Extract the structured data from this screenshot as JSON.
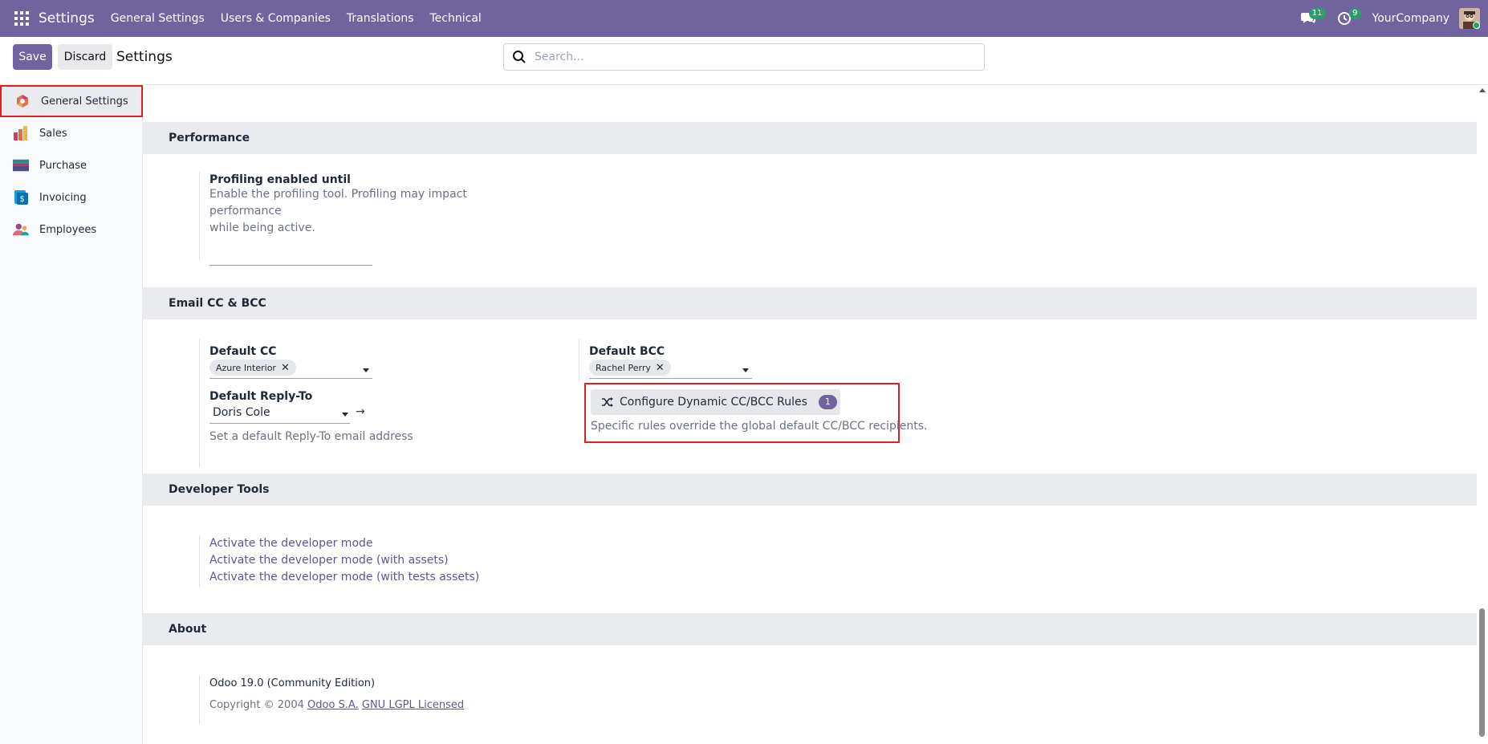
{
  "navbar": {
    "brand": "Settings",
    "menu": [
      "General Settings",
      "Users & Companies",
      "Translations",
      "Technical"
    ],
    "messages_count": "11",
    "activities_count": "9",
    "company": "YourCompany"
  },
  "control": {
    "save_label": "Save",
    "discard_label": "Discard",
    "title": "Settings",
    "search_placeholder": "Search..."
  },
  "sidebar": {
    "items": [
      {
        "label": "General Settings",
        "icon": "general-settings-icon",
        "active": true
      },
      {
        "label": "Sales",
        "icon": "sales-icon"
      },
      {
        "label": "Purchase",
        "icon": "purchase-icon"
      },
      {
        "label": "Invoicing",
        "icon": "invoicing-icon"
      },
      {
        "label": "Employees",
        "icon": "employees-icon"
      }
    ]
  },
  "sections": {
    "performance": {
      "title": "Performance",
      "profiling_label": "Profiling enabled until",
      "profiling_desc_1": "Enable the profiling tool. Profiling may impact performance",
      "profiling_desc_2": "while being active."
    },
    "email": {
      "title": "Email CC & BCC",
      "default_cc_label": "Default CC",
      "default_cc_tag": "Azure Interior",
      "default_bcc_label": "Default BCC",
      "default_bcc_tag": "Rachel Perry",
      "reply_to_label": "Default Reply-To",
      "reply_to_value": "Doris Cole",
      "reply_to_desc": "Set a default Reply-To email address",
      "rules_button": "Configure Dynamic CC/BCC Rules",
      "rules_count": "1",
      "rules_desc": "Specific rules override the global default CC/BCC recipients."
    },
    "developer": {
      "title": "Developer Tools",
      "links": [
        "Activate the developer mode",
        "Activate the developer mode (with assets)",
        "Activate the developer mode (with tests assets)"
      ]
    },
    "about": {
      "title": "About",
      "version": "Odoo 19.0 (Community Edition)",
      "copyright_prefix": "Copyright © 2004",
      "company_link": "Odoo S.A.",
      "license_link": "GNU LGPL Licensed"
    }
  },
  "colors": {
    "navbar": "#71639e",
    "accent": "#71639e",
    "highlight": "#e11d2a",
    "badge": "#26a269"
  }
}
